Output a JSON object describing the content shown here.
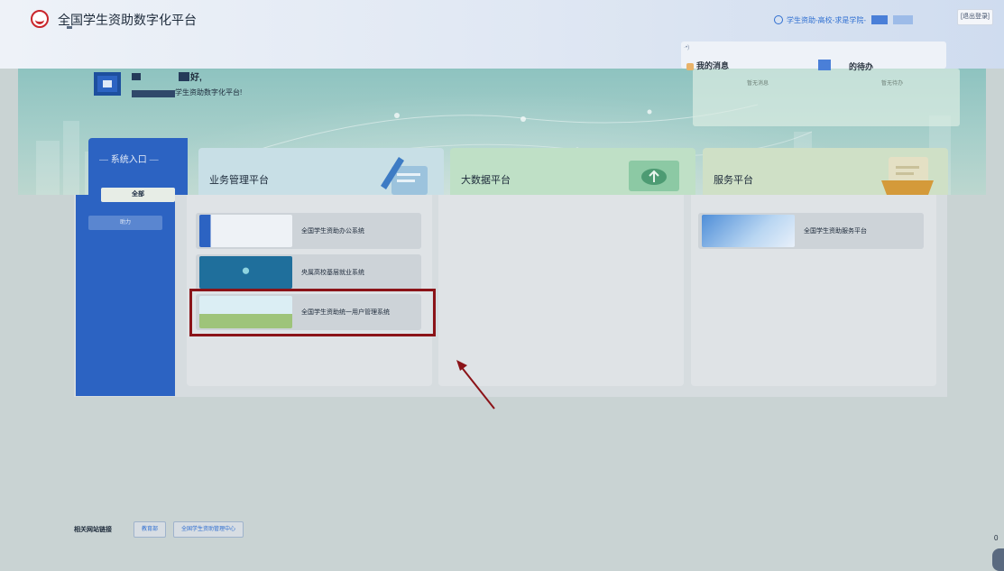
{
  "header": {
    "app_title": "全国学生资助数字化平台",
    "user_org": "学生资助-高校-求是学院-",
    "logout": "[退出登录]"
  },
  "hero": {
    "greeting_suffix": "好,",
    "welcome": "学生资助数字化平台!"
  },
  "messages": {
    "tag": "·•)",
    "my_messages": "我的消息",
    "my_messages_empty": "暂无消息",
    "my_todo": "的待办",
    "my_todo_empty": "暂无待办"
  },
  "sidebar": {
    "title": "系统入口",
    "tabs": [
      "全部",
      "助力"
    ]
  },
  "categories": [
    {
      "label": "业务管理平台",
      "systems": [
        {
          "label": "全国学生资助办公系统"
        },
        {
          "label": "央属高校基层就业系统"
        },
        {
          "label": "全国学生资助统一用户管理系统"
        }
      ]
    },
    {
      "label": "大数据平台",
      "systems": []
    },
    {
      "label": "服务平台",
      "systems": [
        {
          "label": "全国学生资助服务平台"
        }
      ]
    }
  ],
  "footer": {
    "links_label": "相关网站链接",
    "links": [
      "教育部",
      "全国学生资助管理中心"
    ]
  },
  "colors": {
    "primary_blue": "#2c63c2",
    "highlight_red": "#8b1318"
  }
}
